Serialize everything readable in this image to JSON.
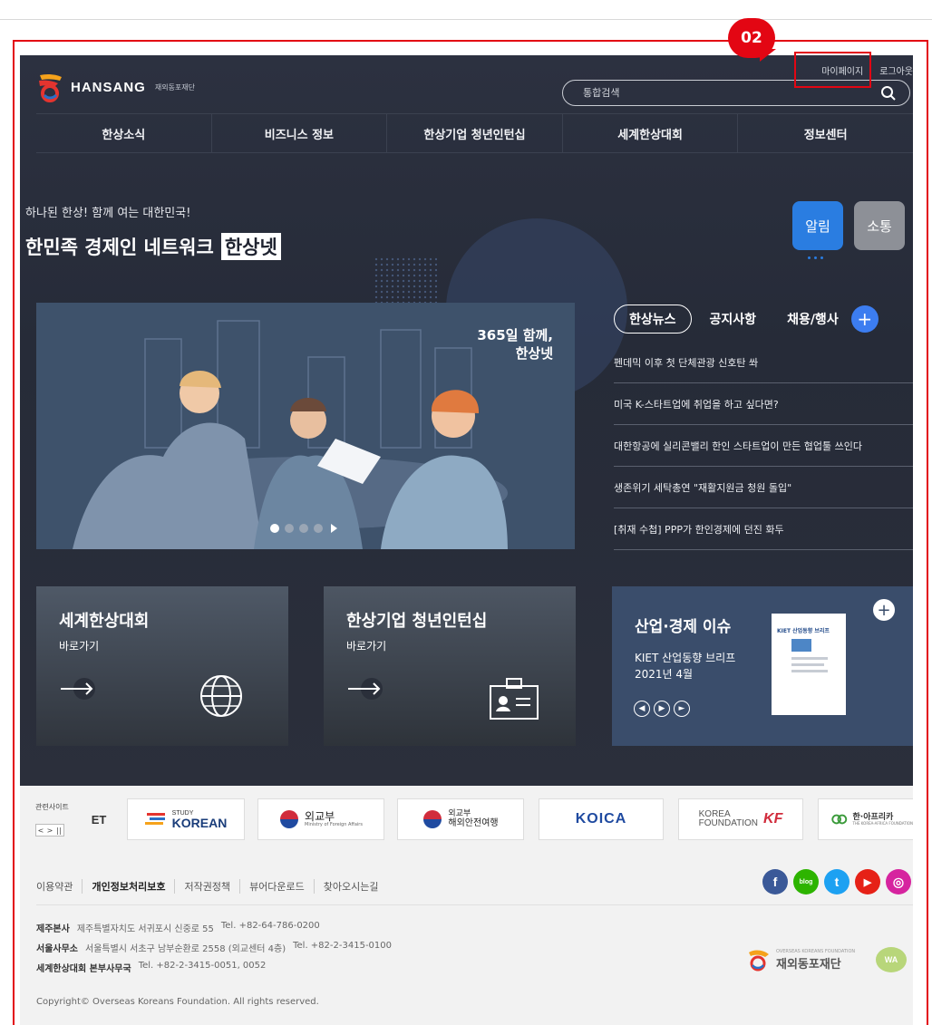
{
  "annotation": {
    "step_badge": "02"
  },
  "header": {
    "logo_text": "HANSANG",
    "logo_sub": "재외동포재단",
    "util_links": [
      "마이페이지",
      "로그아웃"
    ],
    "search_placeholder": "통합검색"
  },
  "gnb": [
    "한상소식",
    "비즈니스 정보",
    "한상기업 청년인턴십",
    "세계한상대회",
    "정보센터"
  ],
  "hero": {
    "tagline": "하나된 한상! 함께 여는 대한민국!",
    "headline": "한민족 경제인 네트워크",
    "headline_highlight": "한상넷",
    "toggle_alarm": "알림",
    "toggle_comm": "소통"
  },
  "banner": {
    "caption_line1": "365일 함께,",
    "caption_line2": "한상넷"
  },
  "news": {
    "tabs": [
      "한상뉴스",
      "공지사항",
      "채용/행사"
    ],
    "more_label": "+",
    "items": [
      "펜데믹 이후 첫 단체관광 신호탄 쏴",
      "미국 K-스타트업에 취업을 하고 싶다면?",
      "대한항공에 실리콘밸리 한인 스타트업이 만든 협업툴 쓰인다",
      "생존위기 세탁총연 \"재활지원금 청원 돌입\"",
      "[취재 수첩] PPP가 한인경제에 던진 화두"
    ]
  },
  "cards": {
    "card1": {
      "title": "세계한상대회",
      "sub": "바로가기"
    },
    "card2": {
      "title": "한상기업 청년인턴십",
      "sub": "바로가기"
    },
    "card3": {
      "title": "산업·경제 이슈",
      "sub1": "KIET 산업동향 브리프",
      "sub2": "2021년 4월",
      "book_title": "KIET 산업동향 브리프",
      "plus": "+"
    }
  },
  "related": {
    "label": "관련사이트",
    "et_fragment": "ET",
    "sites": [
      {
        "line1": "STUDY",
        "line2": "KOREAN"
      },
      {
        "line1": "외교부",
        "line2": "Ministry of Foreign Affairs"
      },
      {
        "line1": "외교부",
        "line2": "해외안전여행"
      },
      {
        "line1": "KOICA",
        "line2": ""
      },
      {
        "line1": "KOREA",
        "line2": "FOUNDATION",
        "mark": "KF"
      },
      {
        "line1": "한·아프리카",
        "line2": "THE KOREA-AFRICA FOUNDATION"
      }
    ]
  },
  "footer": {
    "links": [
      "이용약관",
      "개인정보처리보호",
      "저작권정책",
      "뷰어다운로드",
      "찾아오시는길"
    ],
    "sns": [
      "f",
      "blog",
      "t",
      "▶",
      "◎"
    ],
    "addresses": [
      {
        "name": "제주본사",
        "addr": "제주특별자치도 서귀포시 신중로 55",
        "tel": "Tel. +82-64-786-0200"
      },
      {
        "name": "서울사무소",
        "addr": "서울특별시 서초구 남부순환로 2558 (외교센터 4층)",
        "tel": "Tel. +82-2-3415-0100"
      },
      {
        "name": "세계한상대회 본부사무국",
        "addr": "",
        "tel": "Tel. +82-2-3415-0051, 0052"
      }
    ],
    "copyright": "Copyright© Overseas Koreans Foundation. All rights reserved.",
    "org_small": "OVERSEAS KOREANS FOUNDATION",
    "org_name": "재외동포재단",
    "wa_mark": "WA"
  },
  "colors": {
    "annotation_red": "#e30613",
    "accent_blue": "#2a7de1",
    "hero_bg": "#2a2f3c"
  }
}
